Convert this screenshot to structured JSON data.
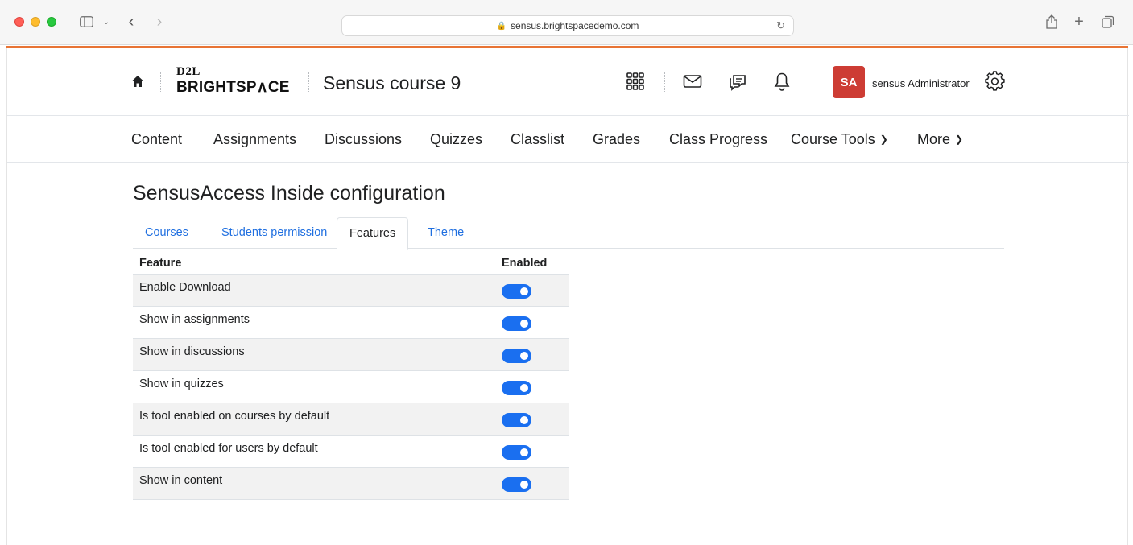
{
  "browser": {
    "url": "sensus.brightspacedemo.com"
  },
  "header": {
    "logo_top": "D2L",
    "logo_bottom": "BRIGHTSP∧CE",
    "course_title": "Sensus course 9",
    "avatar_initials": "SA",
    "user_name": "sensus Administrator"
  },
  "nav": {
    "items": [
      {
        "label": "Content"
      },
      {
        "label": "Assignments"
      },
      {
        "label": "Discussions"
      },
      {
        "label": "Quizzes"
      },
      {
        "label": "Classlist"
      },
      {
        "label": "Grades"
      },
      {
        "label": "Class Progress"
      },
      {
        "label": "Course Tools"
      },
      {
        "label": "More"
      }
    ]
  },
  "page": {
    "title": "SensusAccess Inside configuration",
    "tabs": [
      {
        "label": "Courses"
      },
      {
        "label": "Students permission"
      },
      {
        "label": "Features",
        "active": true
      },
      {
        "label": "Theme"
      }
    ]
  },
  "table": {
    "col_feature": "Feature",
    "col_enabled": "Enabled",
    "rows": [
      {
        "feature": "Enable Download",
        "enabled": true
      },
      {
        "feature": "Show in assignments",
        "enabled": true
      },
      {
        "feature": "Show in discussions",
        "enabled": true
      },
      {
        "feature": "Show in quizzes",
        "enabled": true
      },
      {
        "feature": "Is tool enabled on courses by default",
        "enabled": true
      },
      {
        "feature": "Is tool enabled for users by default",
        "enabled": true
      },
      {
        "feature": "Show in content",
        "enabled": true
      }
    ]
  },
  "colors": {
    "accent_bar": "#e87434",
    "toggle_on": "#1a6ff0",
    "avatar_bg": "#cd3c34",
    "link": "#1f6fe0"
  },
  "icons": [
    "sidebar-icon",
    "chevron-down-icon",
    "back-icon",
    "forward-icon",
    "lock-icon",
    "reload-icon",
    "share-icon",
    "new-tab-icon",
    "tab-overview-icon",
    "home-icon",
    "waffle-icon",
    "mail-icon",
    "chat-icon",
    "bell-icon",
    "gear-icon"
  ]
}
